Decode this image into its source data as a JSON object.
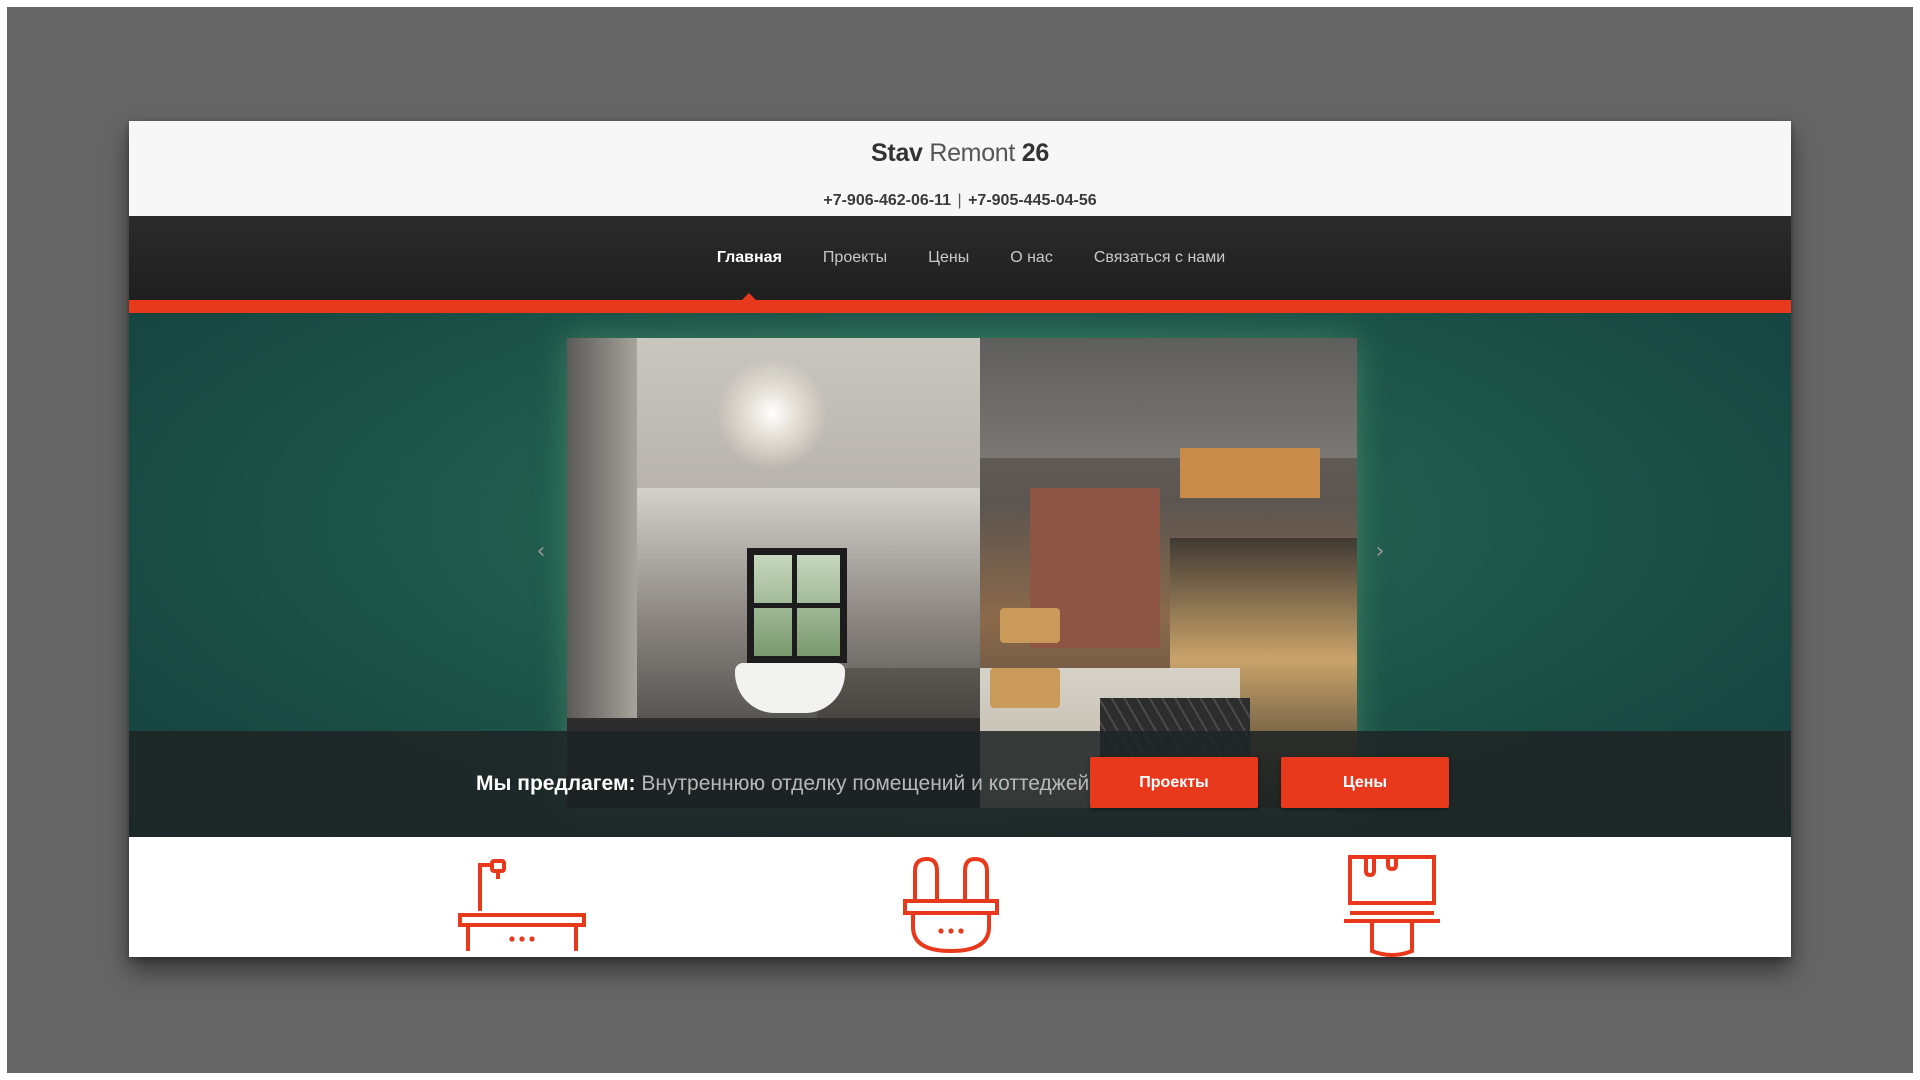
{
  "header": {
    "logo_bold": "Stav",
    "logo_light": "Remont",
    "logo_number": "26",
    "phone_1": "+7-906-462-06-11",
    "phone_separator": "|",
    "phone_2": "+7-905-445-04-56"
  },
  "nav": {
    "items": [
      {
        "label": "Главная",
        "active": true
      },
      {
        "label": "Проекты",
        "active": false
      },
      {
        "label": "Цены",
        "active": false
      },
      {
        "label": "О нас",
        "active": false
      },
      {
        "label": "Связаться с нами",
        "active": false
      }
    ]
  },
  "hero": {
    "caption_lead": "Мы предлагем:",
    "caption_text": "Внутреннюю отделку помещений и коттеджей",
    "buttons": {
      "projects": "Проекты",
      "prices": "Цены"
    },
    "prev_icon": "chevron-left-icon",
    "next_icon": "chevron-right-icon"
  },
  "features": {
    "icons": [
      "bathtub-icon",
      "plug-icon",
      "paint-brush-icon"
    ]
  },
  "colors": {
    "accent": "#e8391d",
    "nav_bg": "#262626",
    "hero_bg": "#1f5a4c",
    "backdrop": "#656565"
  }
}
